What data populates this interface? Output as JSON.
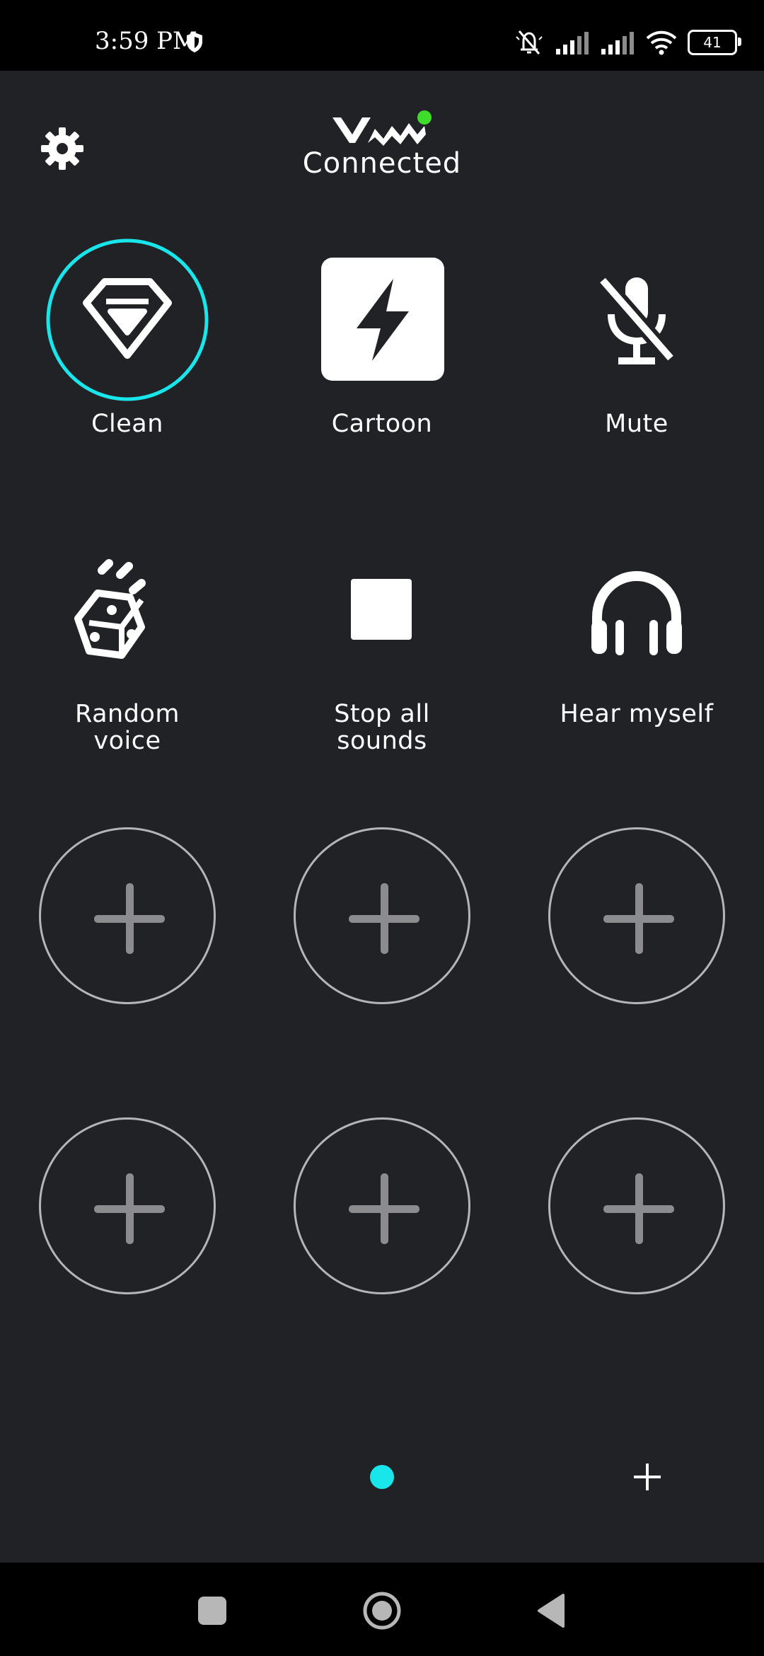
{
  "status_bar": {
    "time": "3:59 PM",
    "battery": "41",
    "icons": [
      "shield-icon",
      "bell-muted-icon",
      "signal-icon",
      "signal-icon",
      "wifi-icon",
      "battery-icon"
    ]
  },
  "header": {
    "settings_icon": "gear-icon",
    "logo": "VM",
    "connection_status": "Connected",
    "status_color": "#3fdc2b"
  },
  "tiles": [
    {
      "label": "Clean",
      "icon": "diamond-icon",
      "selected": true
    },
    {
      "label": "Cartoon",
      "icon": "lightning-icon",
      "selected": false
    },
    {
      "label": "Mute",
      "icon": "mic-off-icon",
      "selected": false
    },
    {
      "label_line1": "Random",
      "label_line2": "voice",
      "icon": "dice-icon"
    },
    {
      "label_line1": "Stop all",
      "label_line2": "sounds",
      "icon": "stop-icon"
    },
    {
      "label": "Hear myself",
      "icon": "headphones-icon"
    }
  ],
  "empty_slots": 6,
  "pager": {
    "active_color": "#19e6ea",
    "add_page_icon": "plus-icon"
  },
  "accent_color": "#19e6ea",
  "nav_bar": {
    "icons": [
      "recents-icon",
      "home-icon",
      "back-icon"
    ]
  }
}
